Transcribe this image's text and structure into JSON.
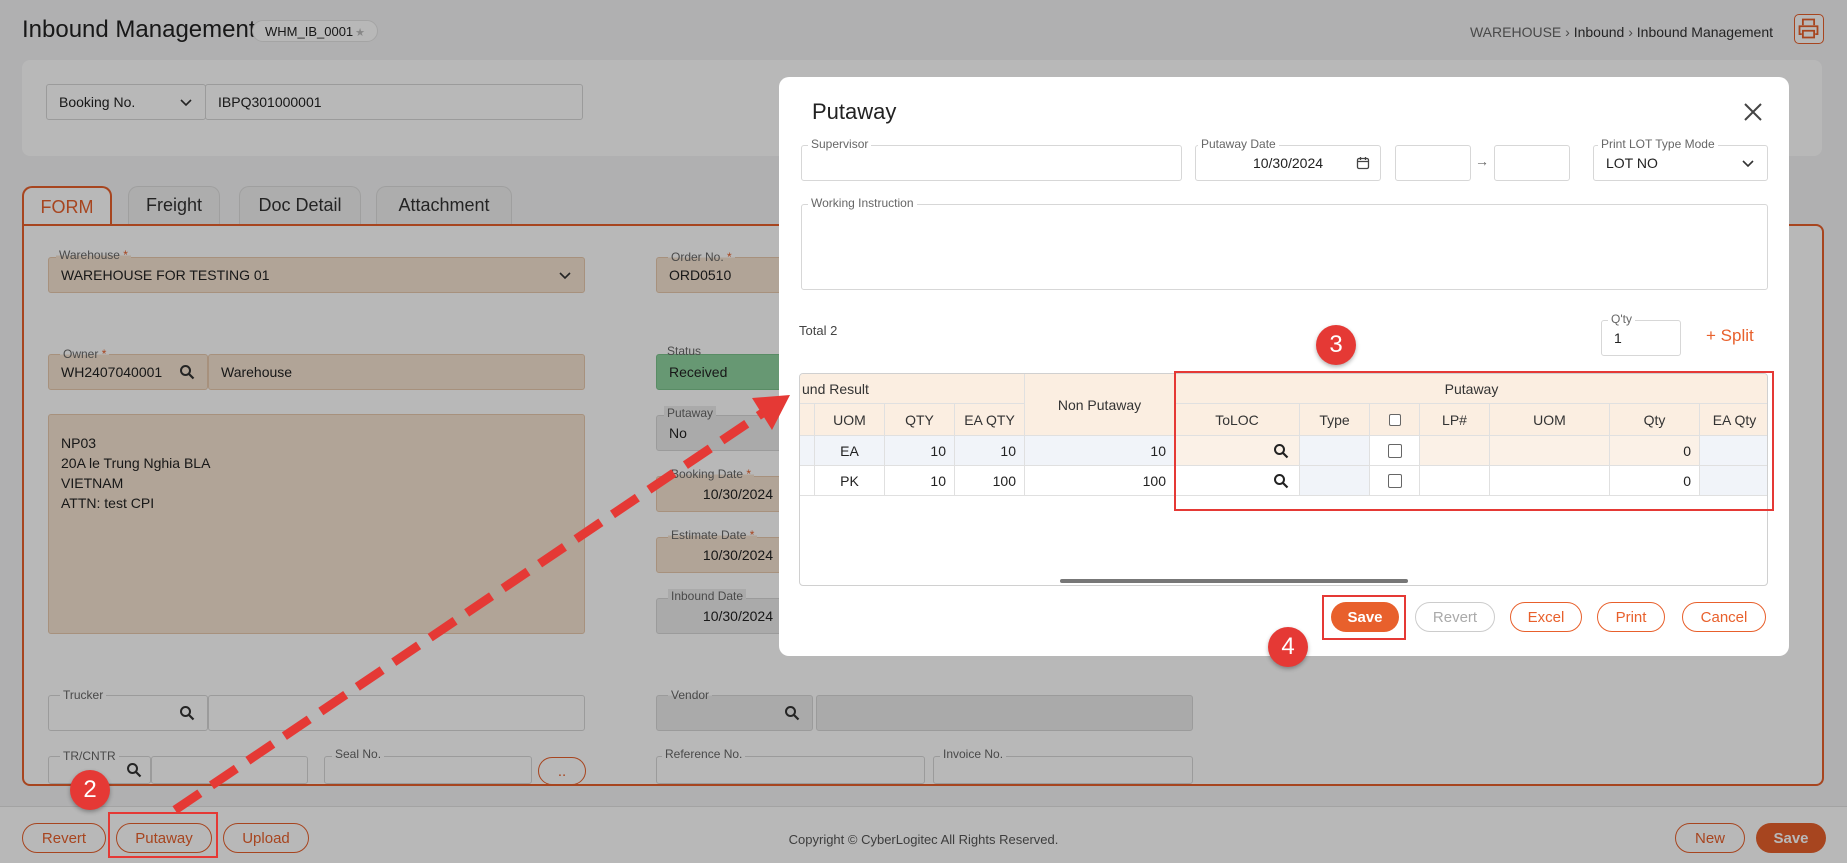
{
  "header": {
    "title": "Inbound Management",
    "code": "WHM_IB_0001",
    "breadcrumb": [
      "WAREHOUSE",
      "Inbound",
      "Inbound Management"
    ]
  },
  "search": {
    "type_label": "Booking No.",
    "value": "IBPQ301000001"
  },
  "tabs": [
    "FORM",
    "Freight",
    "Doc Detail",
    "Attachment"
  ],
  "form": {
    "warehouse_label": "Warehouse",
    "warehouse_value": "WAREHOUSE FOR TESTING 01",
    "order_label": "Order No.",
    "order_value": "ORD0510",
    "owner_label": "Owner",
    "owner_code": "WH2407040001",
    "owner_name": "Warehouse",
    "status_label": "Status",
    "status_value": "Received",
    "putaway_label": "Putaway",
    "putaway_value": "No",
    "booking_date_label": "Booking Date",
    "booking_date_value": "10/30/2024",
    "estimate_date_label": "Estimate Date",
    "estimate_date_value": "10/30/2024",
    "inbound_date_label": "Inbound Date",
    "inbound_date_value": "10/30/2024",
    "address_lines": [
      "NP03",
      "20A le Trung Nghia BLA",
      "VIETNAM",
      "ATTN: test CPI"
    ],
    "trucker_label": "Trucker",
    "vendor_label": "Vendor",
    "trcntr_label": "TR/CNTR",
    "seal_label": "Seal No.",
    "more_label": "..",
    "reference_label": "Reference No.",
    "invoice_label": "Invoice No."
  },
  "footer": {
    "revert": "Revert",
    "putaway": "Putaway",
    "upload": "Upload",
    "copyright": "Copyright © CyberLogitec All Rights Reserved.",
    "new": "New",
    "save": "Save"
  },
  "modal": {
    "title": "Putaway",
    "supervisor_label": "Supervisor",
    "putaway_date_label": "Putaway Date",
    "putaway_date_value": "10/30/2024",
    "range_arrow": "→",
    "print_lot_label": "Print LOT Type Mode",
    "print_lot_value": "LOT NO",
    "instruction_label": "Working Instruction",
    "total": "Total 2",
    "qty_label": "Q'ty",
    "qty_value": "1",
    "split": "+ Split",
    "grid": {
      "group_inbound": "und Result",
      "group_putaway": "Putaway",
      "non_putaway": "Non Putaway",
      "cols": [
        "UOM",
        "QTY",
        "EA QTY",
        "ToLOC",
        "Type",
        "LP#",
        "UOM",
        "Qty",
        "EA Qty"
      ],
      "rows": [
        {
          "uom": "EA",
          "qty": "10",
          "ea_qty": "10",
          "non_putaway": "10",
          "put_qty": "0"
        },
        {
          "uom": "PK",
          "qty": "10",
          "ea_qty": "100",
          "non_putaway": "100",
          "put_qty": "0"
        }
      ]
    },
    "buttons": {
      "save": "Save",
      "revert": "Revert",
      "excel": "Excel",
      "print": "Print",
      "cancel": "Cancel"
    }
  },
  "annotations": {
    "b2": "2",
    "b3": "3",
    "b4": "4"
  }
}
